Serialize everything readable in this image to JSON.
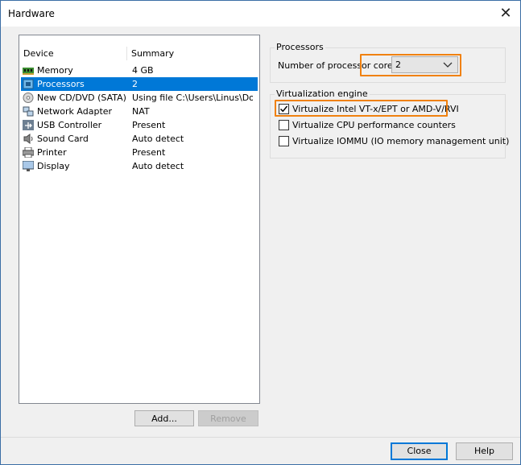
{
  "window": {
    "title": "Hardware"
  },
  "devices": {
    "columns": {
      "device": "Device",
      "summary": "Summary"
    },
    "rows": [
      {
        "name": "Memory",
        "summary": "4 GB",
        "icon": "memory-icon"
      },
      {
        "name": "Processors",
        "summary": "2",
        "icon": "processor-icon",
        "selected": true
      },
      {
        "name": "New CD/DVD (SATA)",
        "summary": "Using file C:\\Users\\Linus\\Do...",
        "icon": "cd-dvd-icon"
      },
      {
        "name": "Network Adapter",
        "summary": "NAT",
        "icon": "network-adapter-icon"
      },
      {
        "name": "USB Controller",
        "summary": "Present",
        "icon": "usb-icon"
      },
      {
        "name": "Sound Card",
        "summary": "Auto detect",
        "icon": "speaker-icon"
      },
      {
        "name": "Printer",
        "summary": "Present",
        "icon": "printer-icon"
      },
      {
        "name": "Display",
        "summary": "Auto detect",
        "icon": "monitor-icon"
      }
    ],
    "add_label": "Add...",
    "remove_label": "Remove"
  },
  "processors": {
    "group_title": "Processors",
    "cores_label": "Number of processor cores:",
    "cores_value": "2"
  },
  "virtualization": {
    "group_title": "Virtualization engine",
    "options": [
      {
        "label": "Virtualize Intel VT-x/EPT or AMD-V/RVI",
        "checked": true
      },
      {
        "label": "Virtualize CPU performance counters",
        "checked": false
      },
      {
        "label": "Virtualize IOMMU (IO memory management unit)",
        "checked": false
      }
    ]
  },
  "footer": {
    "close_label": "Close",
    "help_label": "Help"
  },
  "colors": {
    "selection": "#0078d7",
    "highlight": "#f0810f"
  }
}
